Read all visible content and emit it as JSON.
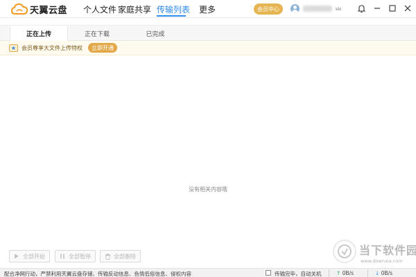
{
  "app": {
    "logo_text": "天翼云盘"
  },
  "nav": {
    "items": [
      {
        "label": "个人文件"
      },
      {
        "label": "家庭共享"
      },
      {
        "label": "传输列表"
      },
      {
        "label": "更多"
      }
    ],
    "active": "传输列表"
  },
  "header": {
    "vip_center": "会员中心"
  },
  "tabs": [
    {
      "label": "正在上传"
    },
    {
      "label": "正在下载"
    },
    {
      "label": "已完成"
    }
  ],
  "active_tab": "正在上传",
  "promo": {
    "text": "会员尊享大文件上传特权",
    "button": "立即开通"
  },
  "empty": {
    "message": "没有相关内容哦"
  },
  "actions": {
    "start_all": "全部开始",
    "pause_all": "全部暂停",
    "delete_all": "全部删除"
  },
  "status": {
    "notice": "配合净网行动，严禁利用天翼云盘存储、传输反动信息、色情低俗信息、侵权内容",
    "shutdown_label": "传输完毕，自动关机",
    "upload_speed": "0B/s",
    "download_speed": "0B/s"
  },
  "watermark": {
    "main": "当下软件园",
    "sub": "www.downxia.com"
  },
  "colors": {
    "accent": "#2d8cf0",
    "vip": "#e6b450",
    "promo_bg": "#fffbef",
    "promo_btn": "#e2a848"
  }
}
